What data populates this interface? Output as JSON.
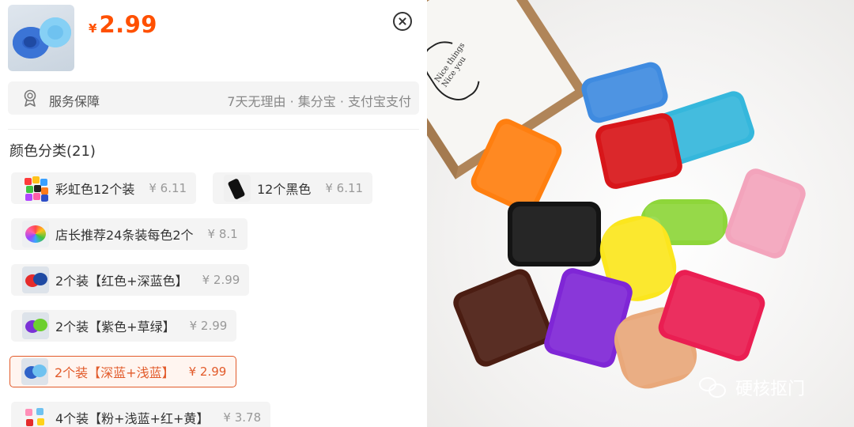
{
  "product": {
    "price_symbol": "¥",
    "price": "2.99",
    "accent_color": "#ff5000"
  },
  "service": {
    "label": "服务保障",
    "info": "7天无理由 · 集分宝 · 支付宝支付",
    "icon": "award-ribbon-icon"
  },
  "category": {
    "title": "颜色分类(21)",
    "options": [
      {
        "name": "彩虹色12个装",
        "price": "¥ 6.11",
        "selected": false
      },
      {
        "name": "12个黑色",
        "price": "¥ 6.11",
        "selected": false
      },
      {
        "name": "店长推荐24条装每色2个",
        "price": "¥ 8.1",
        "selected": false
      },
      {
        "name": "2个装【红色+深蓝色】",
        "price": "¥ 2.99",
        "selected": false
      },
      {
        "name": "2个装【紫色+草绿】",
        "price": "¥ 2.99",
        "selected": false
      },
      {
        "name": "2个装【深蓝+浅蓝】",
        "price": "¥ 2.99",
        "selected": true
      },
      {
        "name": "4个装【粉+浅蓝+红+黄】",
        "price": "¥ 3.78",
        "selected": false
      }
    ],
    "selected_color": "#e25b2b"
  },
  "photo": {
    "watermark": "硬核抠门",
    "frame_text": "Nice things\nNice you"
  }
}
